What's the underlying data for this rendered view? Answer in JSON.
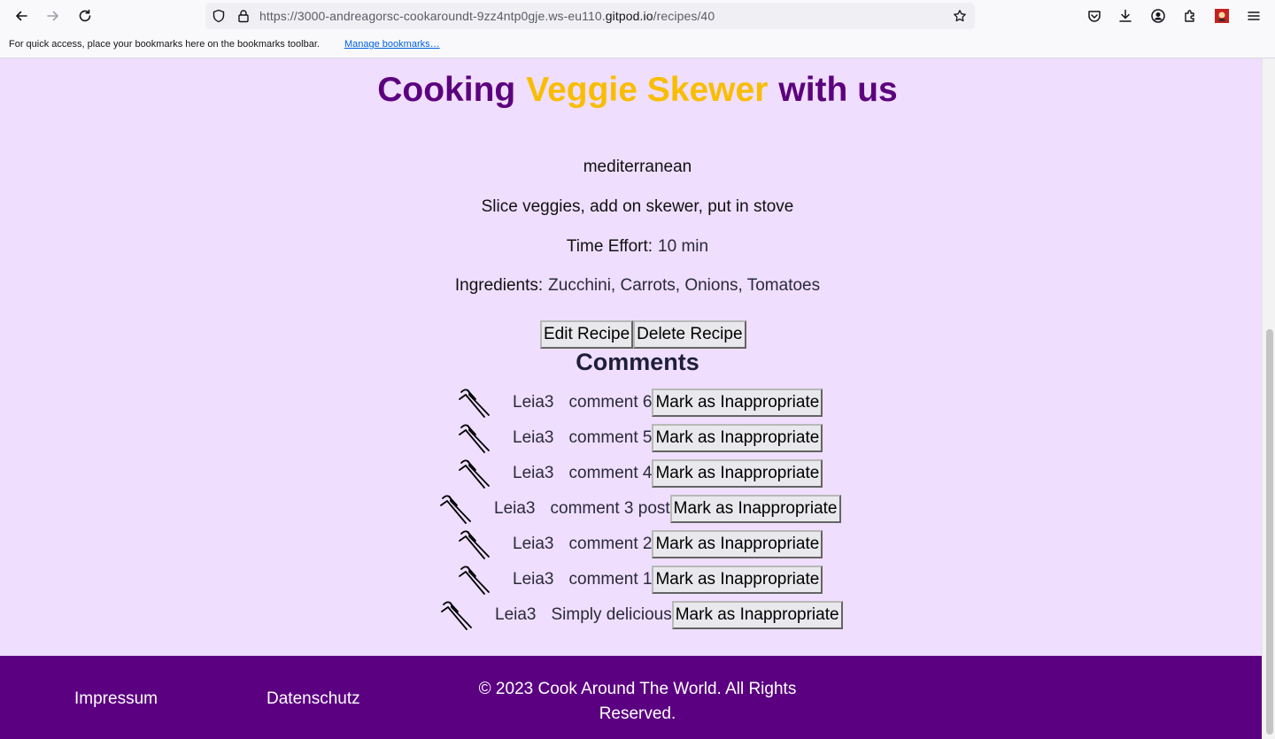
{
  "browser": {
    "url_prefix": "https://3000-andreagorsc-cookaroundt-9zz4ntp0gje.ws-eu110.",
    "url_domain": "gitpod.io",
    "url_path": "/recipes/40",
    "bookmarks_message": "For quick access, place your bookmarks here on the bookmarks toolbar.",
    "bookmarks_link": "Manage bookmarks…"
  },
  "recipe": {
    "title_prefix": "Cooking",
    "title_name": "Veggie Skewer",
    "title_suffix": "with us",
    "cuisine": "mediterranean",
    "instructions": "Slice veggies, add on skewer, put in stove",
    "time_label": "Time Effort:",
    "time_value": "10 min",
    "ingredients_label": "Ingredients:",
    "ingredients_value": "Zucchini, Carrots, Onions, Tomatoes",
    "edit_label": "Edit Recipe",
    "delete_label": "Delete Recipe"
  },
  "comments": {
    "heading": "Comments",
    "flag_label": "Mark as Inappropriate",
    "avatar_icon": "utensils-icon",
    "items": [
      {
        "author": "Leia3",
        "text": "comment 6"
      },
      {
        "author": "Leia3",
        "text": "comment 5"
      },
      {
        "author": "Leia3",
        "text": "comment 4"
      },
      {
        "author": "Leia3",
        "text": "comment 3 post"
      },
      {
        "author": "Leia3",
        "text": "comment 2"
      },
      {
        "author": "Leia3",
        "text": "comment 1"
      },
      {
        "author": "Leia3",
        "text": "Simply delicious"
      }
    ]
  },
  "footer": {
    "impressum": "Impressum",
    "datenschutz": "Datenschutz",
    "copyright": "© 2023 Cook Around The World. All Rights Reserved."
  },
  "colors": {
    "page_bg": "#efdefe",
    "title_purple": "#5c007e",
    "title_yellow": "#f9bd00",
    "footer_bg": "#5b0081"
  }
}
